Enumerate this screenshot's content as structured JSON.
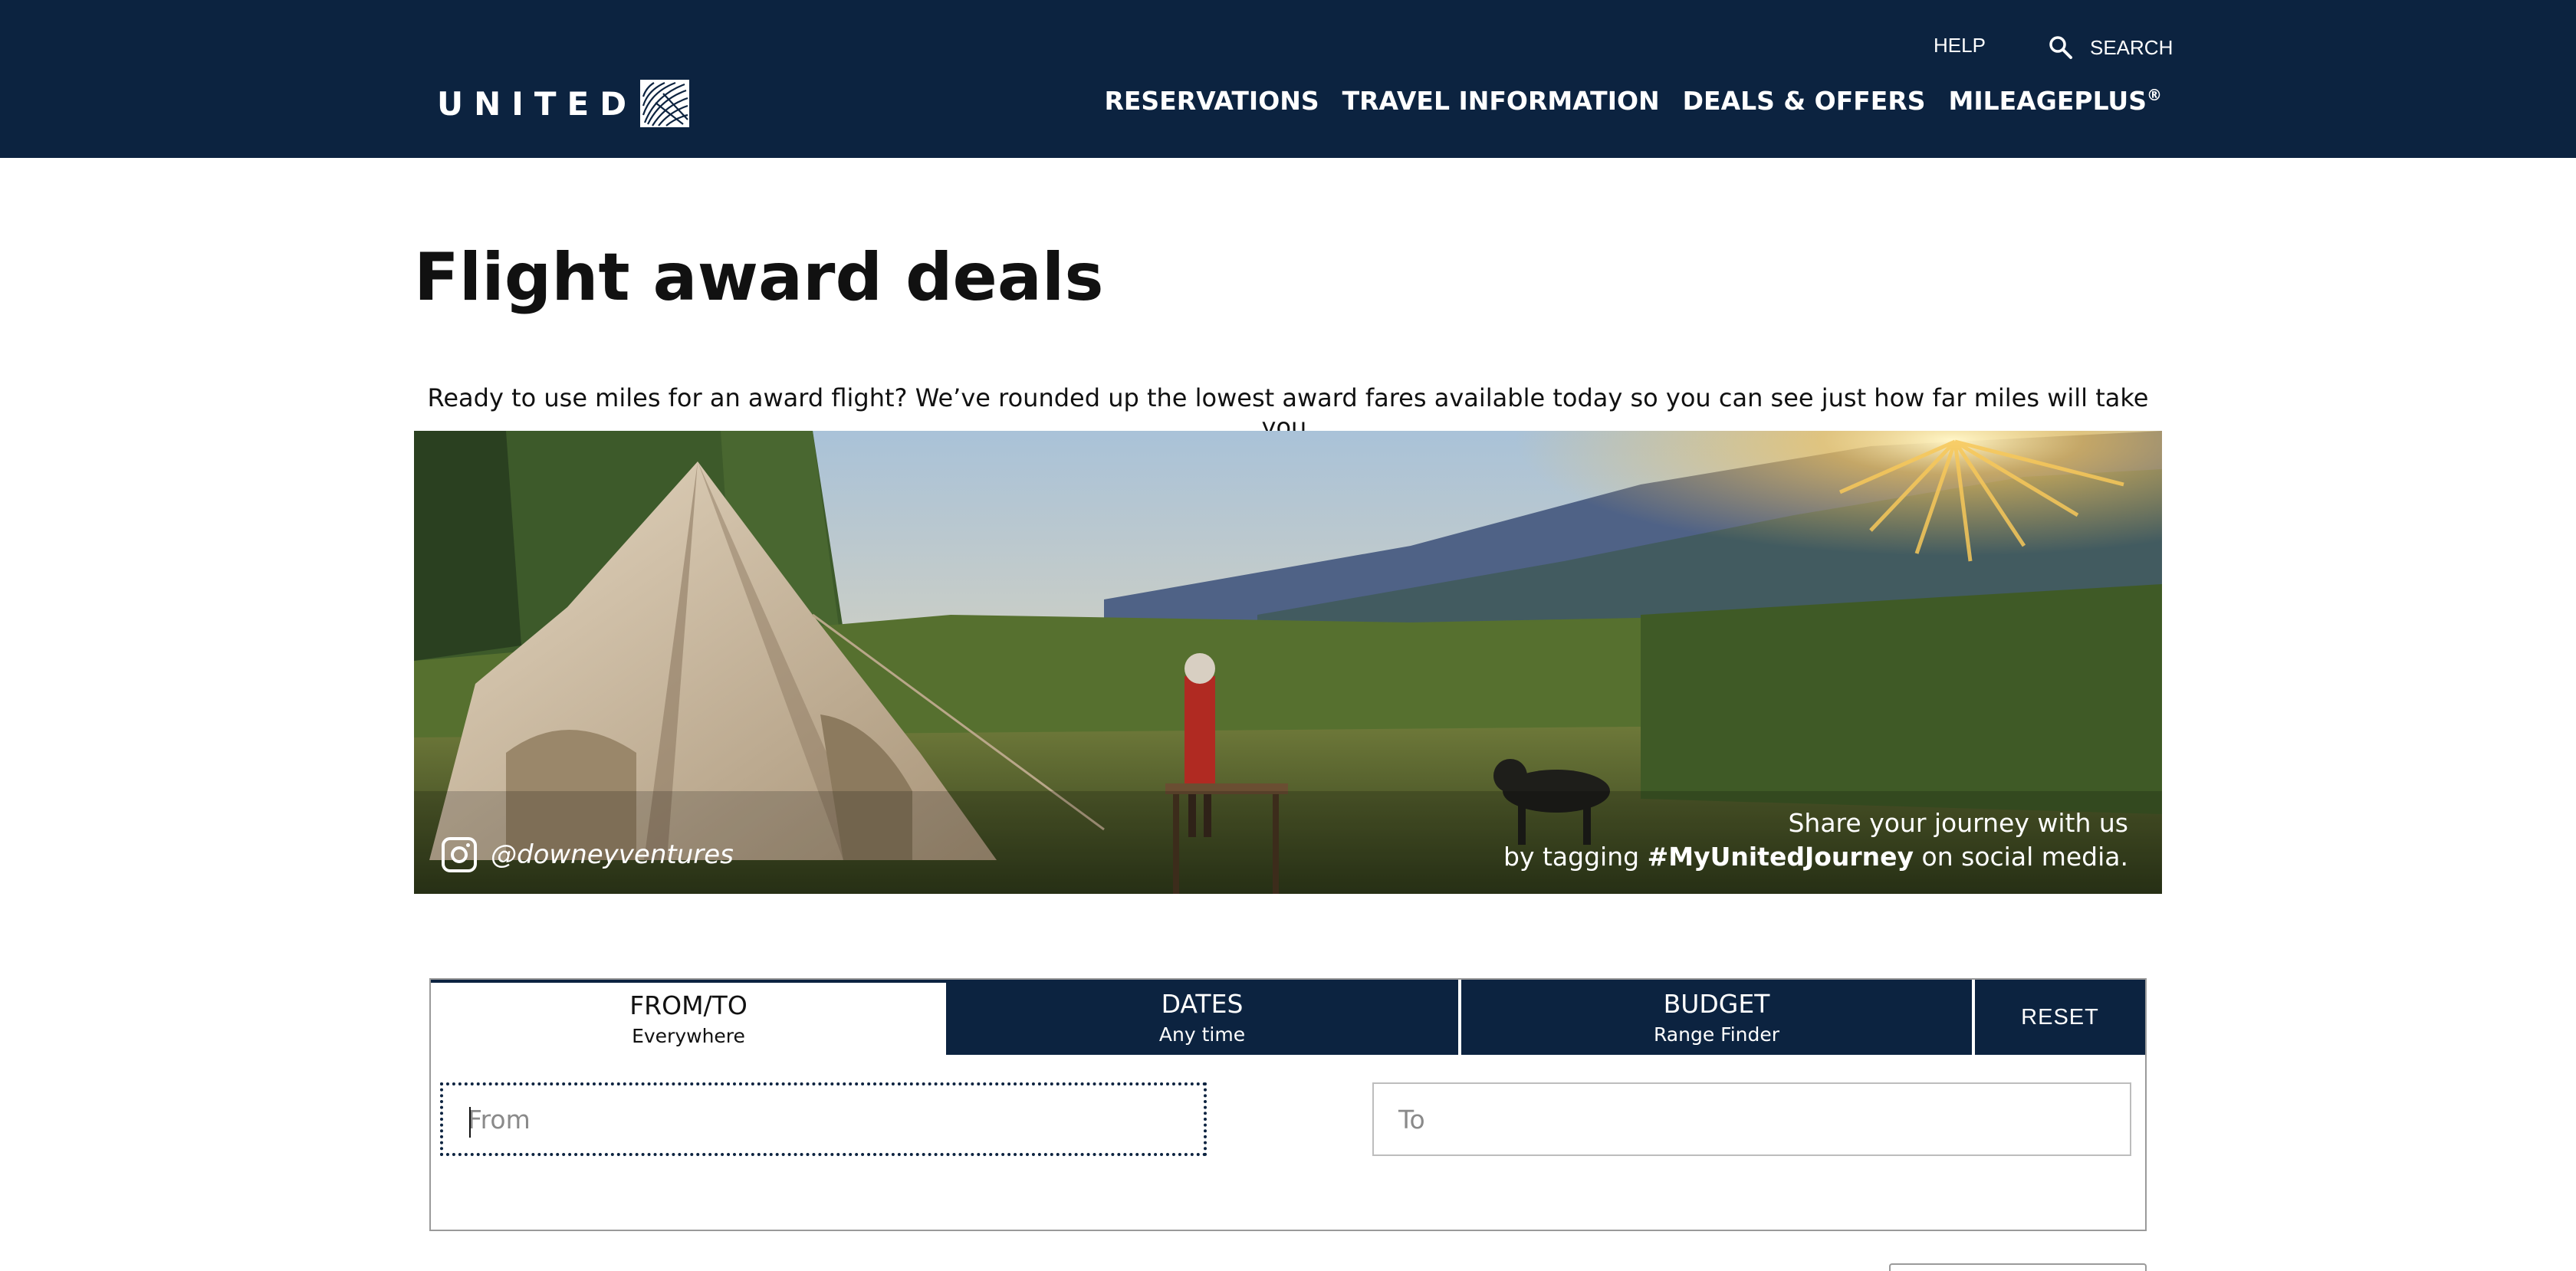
{
  "header": {
    "brand": "UNITED",
    "utility": {
      "help": "HELP",
      "search": "SEARCH"
    },
    "nav": [
      "RESERVATIONS",
      "TRAVEL INFORMATION",
      "DEALS & OFFERS",
      "MILEAGEPLUS"
    ],
    "nav_superscript": "®",
    "background_color": "#0c2340"
  },
  "main": {
    "title": "Flight award deals",
    "intro": "Ready to use miles for an award flight? We’ve rounded up the lowest award fares available today so you can see just how far miles will take you."
  },
  "banner": {
    "instagram_handle": "@downeyventures",
    "share_line1": "Share your journey with us",
    "share_line2_prefix": "by tagging ",
    "share_hashtag": "#MyUnitedJourney",
    "share_line2_suffix": " on social media."
  },
  "search": {
    "tabs": [
      {
        "title": "FROM/TO",
        "sub": "Everywhere",
        "active": true
      },
      {
        "title": "DATES",
        "sub": "Any time",
        "active": false
      },
      {
        "title": "BUDGET",
        "sub": "Range Finder",
        "active": false
      }
    ],
    "reset_label": "RESET",
    "from_placeholder": "From",
    "to_placeholder": "To"
  },
  "icons": [
    "united-globe-icon",
    "search-icon",
    "instagram-icon"
  ]
}
